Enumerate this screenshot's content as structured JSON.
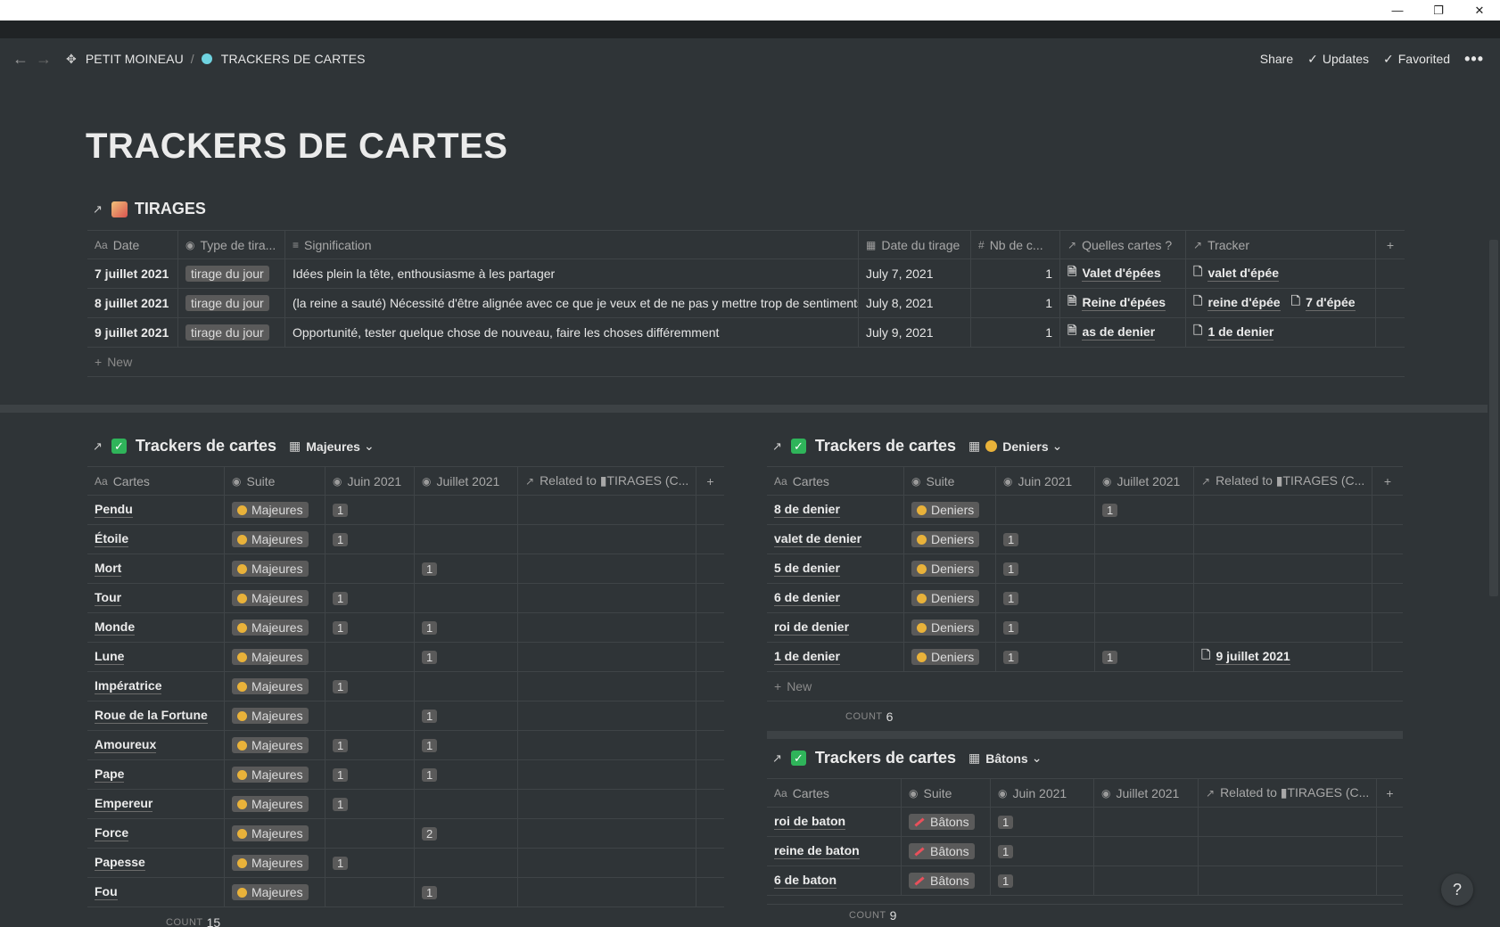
{
  "window": {
    "minimize": "—",
    "restore": "❐",
    "close": "✕"
  },
  "breadcrumb": {
    "workspace": "PETIT MOINEAU",
    "separator": "/",
    "page": "TRACKERS DE CARTES"
  },
  "topbar": {
    "share": "Share",
    "updates": "Updates",
    "favorited": "Favorited",
    "more": "•••"
  },
  "page_title": "TRACKERS DE CARTES",
  "tirages": {
    "title": "TIRAGES",
    "columns": [
      "Date",
      "Type de tira...",
      "Signification",
      "Date du tirage",
      "Nb de c...",
      "Quelles cartes ?",
      "Tracker"
    ],
    "rows": [
      {
        "date": "7 juillet 2021",
        "type": "tirage du jour",
        "signification": "Idées plein la tête, enthousiasme à les partager",
        "date_tirage": "July 7, 2021",
        "nb": "1",
        "cartes": "Valet d'épées",
        "tracker": "valet d'épée",
        "tracker2": ""
      },
      {
        "date": "8 juillet 2021",
        "type": "tirage du jour",
        "signification": "(la reine a sauté) Nécessité d'être alignée avec ce que je veux et de ne pas y mettre trop de sentiments",
        "date_tirage": "July 8, 2021",
        "nb": "1",
        "cartes": "Reine d'épées",
        "tracker": "reine d'épée",
        "tracker2": "7 d'épée"
      },
      {
        "date": "9 juillet 2021",
        "type": "tirage du jour",
        "signification": "Opportunité, tester quelque chose de nouveau, faire les choses différemment",
        "date_tirage": "July 9, 2021",
        "nb": "1",
        "cartes": "as de denier",
        "tracker": "1 de denier",
        "tracker2": ""
      }
    ],
    "new_label": "New"
  },
  "majeures": {
    "title": "Trackers de cartes",
    "view": "Majeures",
    "columns": [
      "Cartes",
      "Suite",
      "Juin 2021",
      "Juillet 2021",
      "Related to ▮TIRAGES (C..."
    ],
    "rows": [
      {
        "carte": "Pendu",
        "suite": "Majeures",
        "juin": "1",
        "juillet": ""
      },
      {
        "carte": "Étoile",
        "suite": "Majeures",
        "juin": "1",
        "juillet": ""
      },
      {
        "carte": "Mort",
        "suite": "Majeures",
        "juin": "",
        "juillet": "1"
      },
      {
        "carte": "Tour",
        "suite": "Majeures",
        "juin": "1",
        "juillet": ""
      },
      {
        "carte": "Monde",
        "suite": "Majeures",
        "juin": "1",
        "juillet": "1"
      },
      {
        "carte": "Lune",
        "suite": "Majeures",
        "juin": "",
        "juillet": "1"
      },
      {
        "carte": "Impératrice",
        "suite": "Majeures",
        "juin": "1",
        "juillet": ""
      },
      {
        "carte": "Roue de la Fortune",
        "suite": "Majeures",
        "juin": "",
        "juillet": "1"
      },
      {
        "carte": "Amoureux",
        "suite": "Majeures",
        "juin": "1",
        "juillet": "1"
      },
      {
        "carte": "Pape",
        "suite": "Majeures",
        "juin": "1",
        "juillet": "1"
      },
      {
        "carte": "Empereur",
        "suite": "Majeures",
        "juin": "1",
        "juillet": ""
      },
      {
        "carte": "Force",
        "suite": "Majeures",
        "juin": "",
        "juillet": "2"
      },
      {
        "carte": "Papesse",
        "suite": "Majeures",
        "juin": "1",
        "juillet": ""
      },
      {
        "carte": "Fou",
        "suite": "Majeures",
        "juin": "",
        "juillet": "1"
      }
    ],
    "count_label": "COUNT",
    "count_value": "15"
  },
  "deniers": {
    "title": "Trackers de cartes",
    "view": "Deniers",
    "columns": [
      "Cartes",
      "Suite",
      "Juin 2021",
      "Juillet 2021",
      "Related to ▮TIRAGES (C..."
    ],
    "rows": [
      {
        "carte": "8 de denier",
        "suite": "Deniers",
        "juin": "",
        "juillet": "1",
        "related": ""
      },
      {
        "carte": "valet de denier",
        "suite": "Deniers",
        "juin": "1",
        "juillet": "",
        "related": ""
      },
      {
        "carte": "5 de denier",
        "suite": "Deniers",
        "juin": "1",
        "juillet": "",
        "related": ""
      },
      {
        "carte": "6 de denier",
        "suite": "Deniers",
        "juin": "1",
        "juillet": "",
        "related": ""
      },
      {
        "carte": "roi de denier",
        "suite": "Deniers",
        "juin": "1",
        "juillet": "",
        "related": ""
      },
      {
        "carte": "1 de denier",
        "suite": "Deniers",
        "juin": "1",
        "juillet": "1",
        "related": "9 juillet 2021"
      }
    ],
    "new_label": "New",
    "count_label": "COUNT",
    "count_value": "6"
  },
  "batons": {
    "title": "Trackers de cartes",
    "view": "Bâtons",
    "columns": [
      "Cartes",
      "Suite",
      "Juin 2021",
      "Juillet 2021",
      "Related to ▮TIRAGES (C..."
    ],
    "rows": [
      {
        "carte": "roi de baton",
        "suite": "Bâtons",
        "juin": "1",
        "juillet": ""
      },
      {
        "carte": "reine de baton",
        "suite": "Bâtons",
        "juin": "1",
        "juillet": ""
      },
      {
        "carte": "6 de baton",
        "suite": "Bâtons",
        "juin": "1",
        "juillet": ""
      }
    ],
    "count_label": "COUNT",
    "count_value": "9"
  },
  "help": "?"
}
